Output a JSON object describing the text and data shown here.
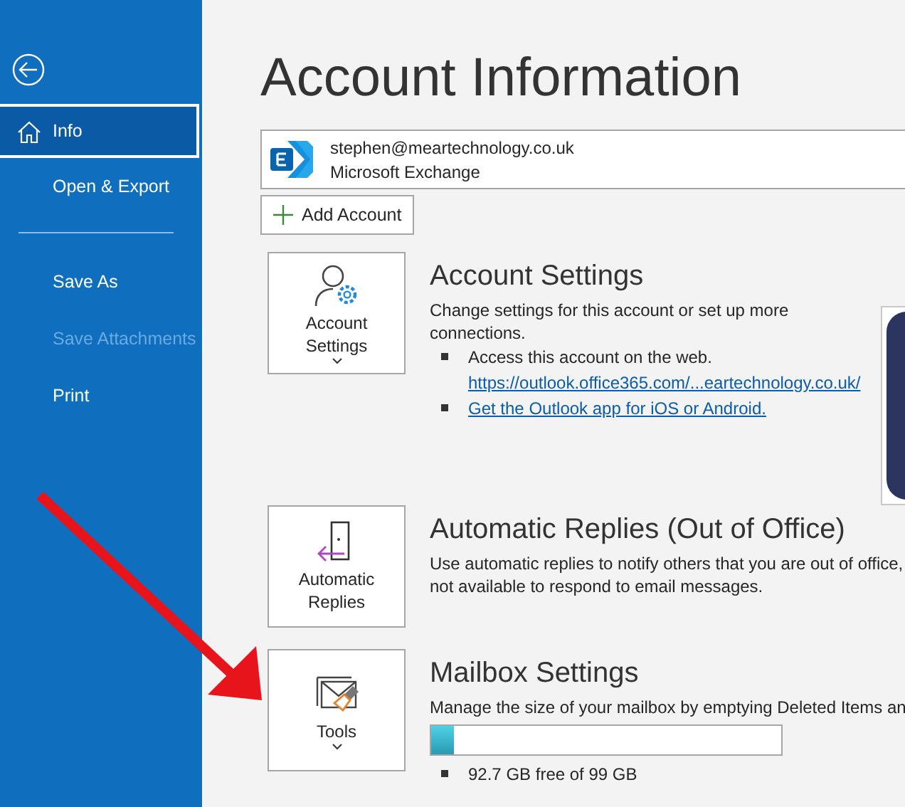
{
  "sidebar": {
    "items": [
      {
        "kind": "home",
        "label": "Info",
        "selected": true,
        "disabled": false
      },
      {
        "kind": "item",
        "label": "Open & Export",
        "selected": false,
        "disabled": false
      },
      {
        "kind": "divider"
      },
      {
        "kind": "item",
        "label": "Save As",
        "selected": false,
        "disabled": false
      },
      {
        "kind": "item",
        "label": "Save Attachments",
        "selected": false,
        "disabled": true
      },
      {
        "kind": "item",
        "label": "Print",
        "selected": false,
        "disabled": false
      }
    ]
  },
  "page_title": "Account Information",
  "account": {
    "email": "stephen@meartechnology.co.uk",
    "type": "Microsoft Exchange"
  },
  "add_account": "Add Account",
  "sections": [
    {
      "kind": "account",
      "tile": [
        "Account",
        "Settings"
      ],
      "tile_caret": true,
      "title": "Account Settings",
      "description": "Change settings for this account or set up more connections.",
      "bullets": [
        {
          "text": "Access this account on the web.",
          "link": "https://outlook.office365.com/...eartechnology.co.uk/"
        },
        {
          "link": "Get the Outlook app for iOS or Android."
        }
      ]
    },
    {
      "kind": "replies",
      "tile": [
        "Automatic",
        "Replies"
      ],
      "tile_caret": false,
      "title": "Automatic Replies (Out of Office)",
      "description": "Use automatic replies to notify others that you are out of office,",
      "description_2": "not available to respond to email messages."
    },
    {
      "kind": "tools",
      "tile": [
        "Tools"
      ],
      "tile_caret": true,
      "title": "Mailbox Settings",
      "description": "Manage the size of your mailbox by emptying Deleted Items an",
      "level": 0.064,
      "bullets": [
        {
          "text": "92.7 GB free of 99 GB"
        }
      ]
    }
  ]
}
